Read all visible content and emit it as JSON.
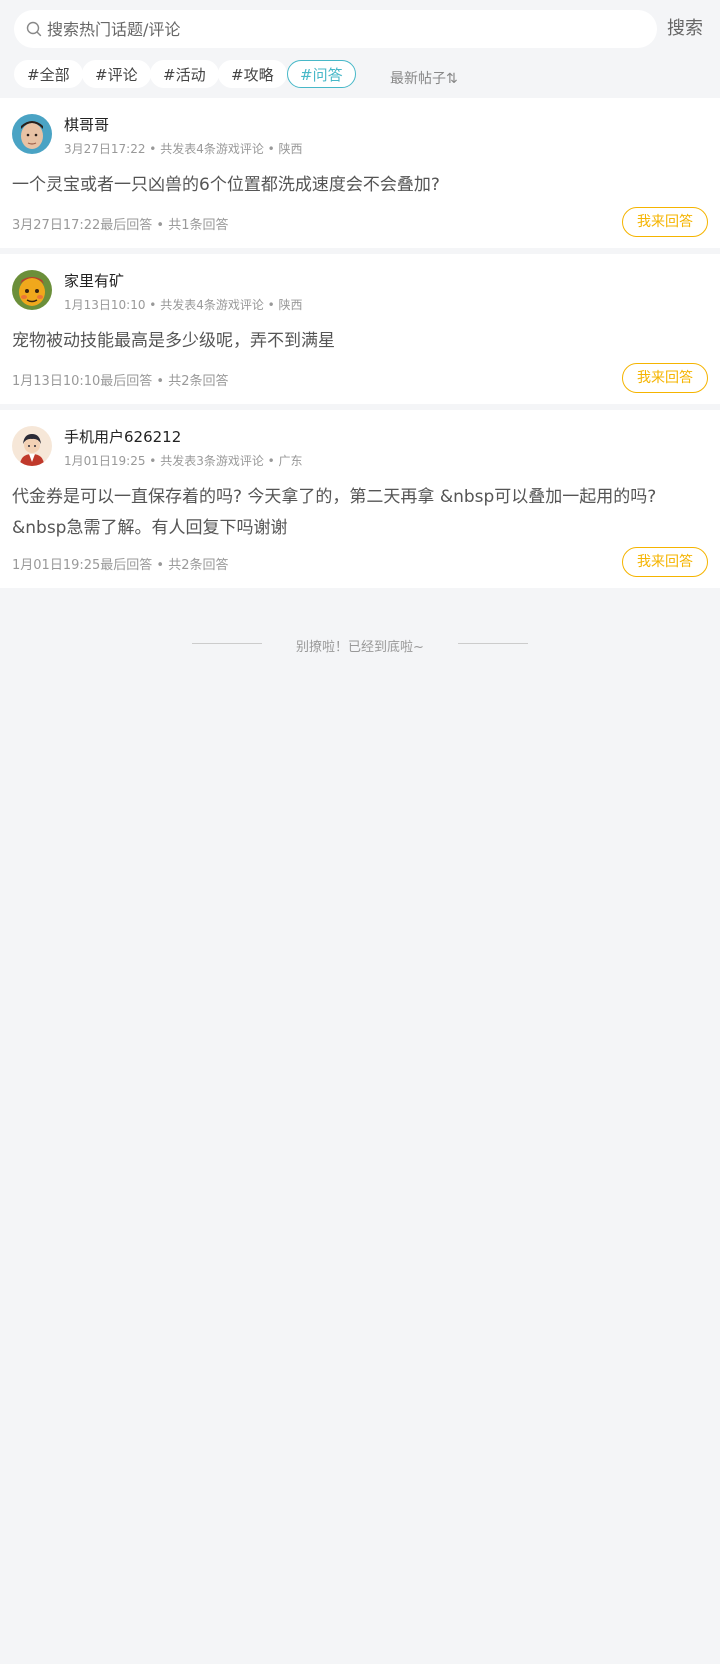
{
  "search": {
    "placeholder": "搜索热门话题/评论",
    "button_label": "搜索"
  },
  "tags": [
    {
      "label": "#全部",
      "active": false
    },
    {
      "label": "#评论",
      "active": false
    },
    {
      "label": "#活动",
      "active": false
    },
    {
      "label": "#攻略",
      "active": false
    },
    {
      "label": "#问答",
      "active": true
    }
  ],
  "sort_label": "最新帖子⇅",
  "posts": [
    {
      "username": "棋哥哥",
      "meta": "3月27日17:22 • 共发表4条游戏评论 • 陕西",
      "text": "一个灵宝或者一只凶兽的6个位置都洗成速度会不会叠加?",
      "footer": "3月27日17:22最后回答 • 共1条回答",
      "answer_label": "我来回答"
    },
    {
      "username": "家里有矿",
      "meta": "1月13日10:10 • 共发表4条游戏评论 • 陕西",
      "text": "宠物被动技能最高是多少级呢，弄不到满星",
      "footer": "1月13日10:10最后回答 • 共2条回答",
      "answer_label": "我来回答"
    },
    {
      "username": "手机用户626212",
      "meta": "1月01日19:25 • 共发表3条游戏评论 • 广东",
      "text": "代金券是可以一直保存着的吗?  今天拿了的，第二天再拿 &nbsp可以叠加一起用的吗? &nbsp急需了解。有人回复下吗谢谢",
      "footer": "1月01日19:25最后回答 • 共2条回答",
      "answer_label": "我来回答"
    }
  ],
  "end_notice": "别撩啦！已经到底啦~",
  "colors": {
    "accent_teal": "#47b8c8",
    "answer_yellow": "#f5b400",
    "background": "#f4f5f7"
  }
}
